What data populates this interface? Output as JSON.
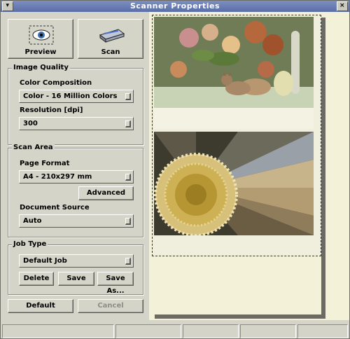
{
  "window": {
    "title": "Scanner Properties"
  },
  "toolbar": {
    "preview_label": "Preview",
    "scan_label": "Scan"
  },
  "image_quality": {
    "title": "Image Quality",
    "color_label": "Color Composition",
    "color_value": "Color - 16 Million Colors",
    "resolution_label": "Resolution [dpi]",
    "resolution_value": "300"
  },
  "scan_area": {
    "title": "Scan Area",
    "page_format_label": "Page Format",
    "page_format_value": "A4 - 210x297 mm",
    "advanced_label": "Advanced",
    "source_label": "Document Source",
    "source_value": "Auto"
  },
  "job_type": {
    "title": "Job Type",
    "value": "Default Job",
    "delete_label": "Delete",
    "save_label": "Save",
    "save_as_label": "Save As..."
  },
  "footer": {
    "default_label": "Default",
    "cancel_label": "Cancel"
  },
  "icons": {
    "preview": "eye-icon",
    "scan": "scanner-icon"
  }
}
